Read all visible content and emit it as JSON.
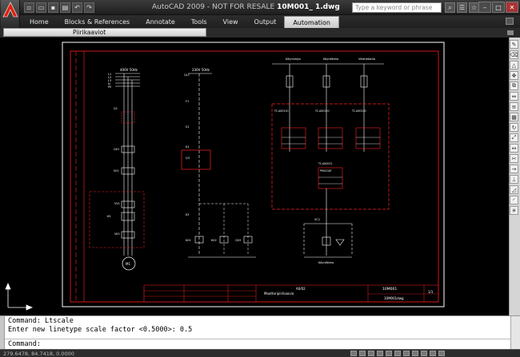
{
  "window": {
    "title_prefix": "AutoCAD 2009 - NOT FOR RESALE ",
    "title_file": "10M001_ 1.dwg",
    "search_placeholder": "Type a keyword or phrase"
  },
  "ribbon": {
    "tabs": [
      {
        "label": "Home",
        "active": false
      },
      {
        "label": "Blocks & References",
        "active": false
      },
      {
        "label": "Annotate",
        "active": false
      },
      {
        "label": "Tools",
        "active": false
      },
      {
        "label": "View",
        "active": false
      },
      {
        "label": "Output",
        "active": false
      },
      {
        "label": "Automation",
        "active": true
      }
    ],
    "panel_label": "Piirikaaviot"
  },
  "drawing": {
    "supply_left": "400V 50Hz",
    "supply_right": "230V 50Hz",
    "phases": [
      "L1",
      "L2",
      "L3",
      "N",
      "PE"
    ],
    "labels": {
      "q1": "Q1",
      "q01": "Q01",
      "s01": "S01",
      "vv1": "VV1",
      "k5": "K5",
      "vk1": "VK1",
      "m1": "M1",
      "ql1": "QL1",
      "f1": "F1",
      "s1": "S1",
      "k1": "K1",
      "q3": "Q3",
      "k3": "K3",
      "k01": "K01",
      "k02": "K02",
      "q03": "Q03",
      "vc1": "VC1"
    },
    "top_labels": [
      "Käynnistys",
      "Käyntitieto",
      "Vikatietotila"
    ],
    "io_labels": [
      "TC.AX0110",
      "TC.AX0120",
      "TC.AX0130"
    ],
    "module_label": "TC.AX0031",
    "module_text": "PM01SAT",
    "bottom_label": "Käyntitieto",
    "title_block": {
      "drawing_no": "10M001",
      "title": "Moottoripiirikaavio",
      "code": "10M001dwg",
      "sheet": "1/1",
      "rev": "A0/02"
    }
  },
  "command": {
    "line1": "Command: Ltscale",
    "line2": "Enter new linetype scale factor <0.5000>: 0.5",
    "prompt": "Command:"
  },
  "status": {
    "coords": "279.6478, 84.7418, 0.0000"
  },
  "colors": {
    "background": "#000000",
    "frame": "#ff0000",
    "lines": "#ffffff",
    "accent": "#ff3c3c"
  },
  "icons": [
    "app-logo-icon",
    "new-icon",
    "open-icon",
    "save-icon",
    "print-icon",
    "undo-icon",
    "redo-icon",
    "search-icon",
    "help-icon",
    "minimize-icon",
    "maximize-icon",
    "close-icon"
  ]
}
